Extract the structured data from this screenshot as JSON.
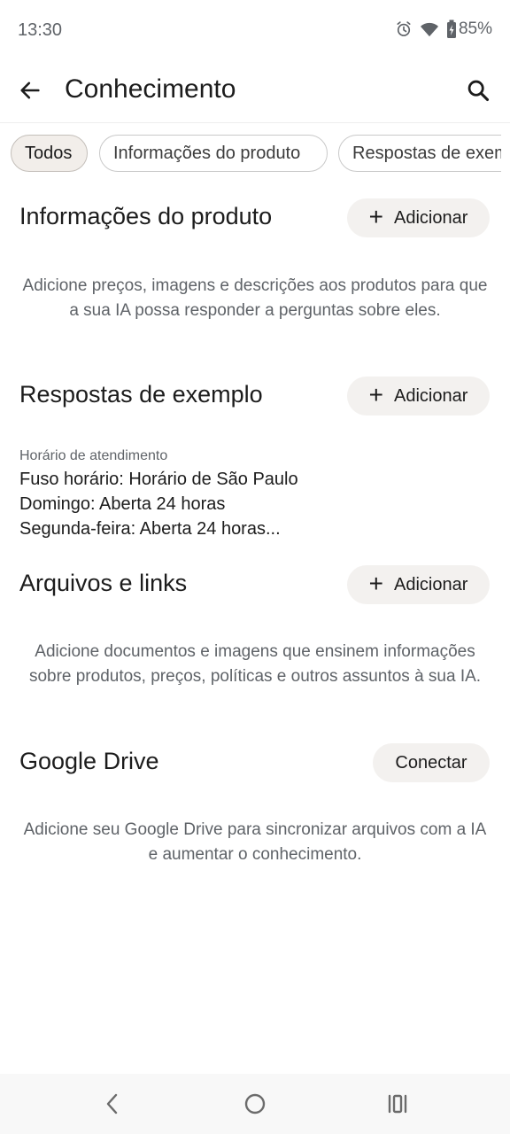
{
  "status_bar": {
    "time": "13:30",
    "battery": "85%",
    "icons": [
      "alarm-icon",
      "wifi-icon",
      "battery-charging-icon"
    ]
  },
  "app_bar": {
    "title": "Conhecimento",
    "back_icon": "arrow-back-icon",
    "search_icon": "search-icon"
  },
  "chips": [
    {
      "label": "Todos",
      "selected": true
    },
    {
      "label": "Informações do produto",
      "selected": false
    },
    {
      "label": "Respostas de exemplo",
      "selected": false
    }
  ],
  "sections": {
    "product_info": {
      "title": "Informações do produto",
      "button_label": "Adicionar",
      "description": "Adicione preços, imagens e descrições aos produtos para que a sua IA possa responder a perguntas sobre eles."
    },
    "example_answers": {
      "title": "Respostas de exemplo",
      "button_label": "Adicionar",
      "caption": "Horário de atendimento",
      "lines": [
        "Fuso horário: Horário de São Paulo",
        "Domingo: Aberta 24 horas",
        "Segunda-feira: Aberta 24 horas..."
      ]
    },
    "files_links": {
      "title": "Arquivos e links",
      "button_label": "Adicionar",
      "description": "Adicione documentos e imagens que ensinem informações sobre produtos, preços, políticas e outros assuntos à sua IA."
    },
    "google_drive": {
      "title": "Google Drive",
      "button_label": "Conectar",
      "description": "Adicione seu Google Drive para sincronizar arquivos com a IA e aumentar o conhecimento."
    }
  },
  "nav_bar": {
    "icons": [
      "nav-back-icon",
      "home-icon",
      "recents-icon"
    ]
  }
}
